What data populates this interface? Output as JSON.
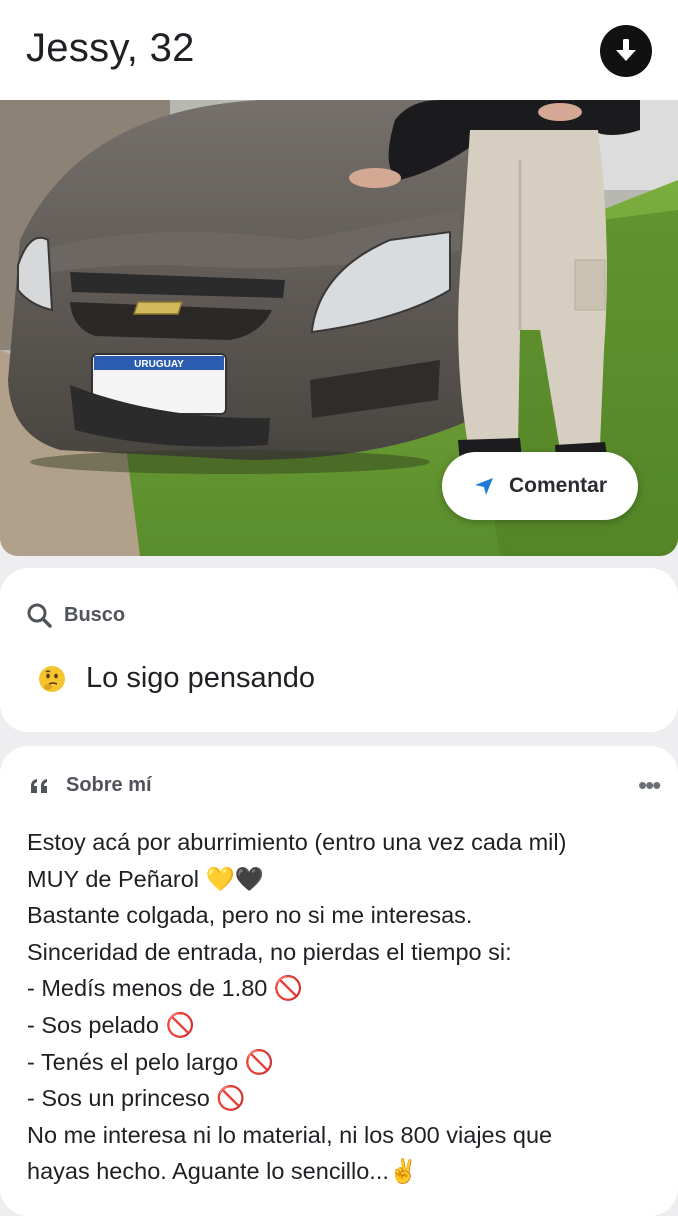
{
  "profile": {
    "name_age": "Jessy, 32"
  },
  "photo": {
    "plate_text": "URUGUAY"
  },
  "actions": {
    "comment_label": "Comentar"
  },
  "busco": {
    "heading": "Busco",
    "value": "Lo sigo pensando",
    "value_emoji": "thinking-face"
  },
  "sobre": {
    "heading": "Sobre mí",
    "menu": "•••",
    "lines": [
      "Estoy acá por aburrimiento (entro una vez cada mil)",
      "MUY de Peñarol 💛🖤",
      "Bastante colgada, pero no si me interesas.",
      "Sinceridad de entrada, no pierdas el tiempo si:",
      "- Medís menos de 1.80 🚫",
      "- Sos pelado 🚫",
      "- Tenés el pelo largo 🚫",
      "- Sos un princeso 🚫",
      "No me interesa ni lo material, ni los 800 viajes que",
      "hayas hecho. Aguante lo sencillo...✌️"
    ]
  },
  "colors": {
    "background": "#eeeef0",
    "card": "#ffffff",
    "text": "#1f2024",
    "muted": "#505359",
    "accent_blue": "#1e7bd8",
    "emoji_yellow": "#f5c530",
    "no_red": "#e53950"
  },
  "icons": [
    "download-arrow-icon",
    "send-arrow-icon",
    "search-icon",
    "quote-icon",
    "more-icon",
    "thinking-emoji"
  ]
}
